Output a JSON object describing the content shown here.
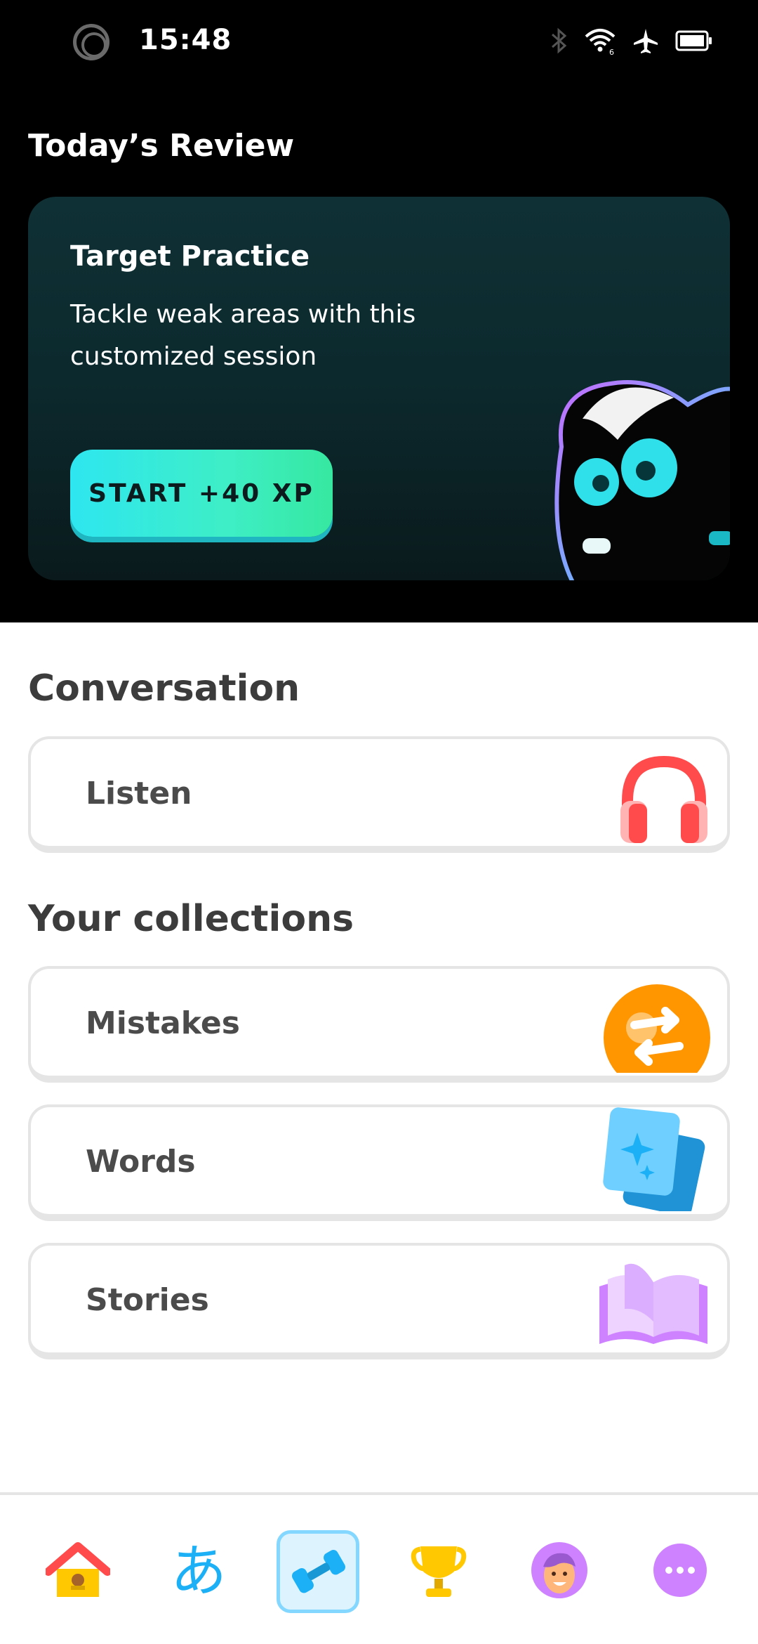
{
  "status_bar": {
    "time": "15:48"
  },
  "review": {
    "section_title": "Today’s Review",
    "card": {
      "title": "Target Practice",
      "description": "Tackle weak areas with this customized session",
      "start_label": "START +40 XP"
    }
  },
  "conversation": {
    "heading": "Conversation",
    "items": [
      {
        "label": "Listen",
        "icon": "headphones-icon"
      }
    ]
  },
  "collections": {
    "heading": "Your collections",
    "items": [
      {
        "label": "Mistakes",
        "icon": "repeat-arrows-icon"
      },
      {
        "label": "Words",
        "icon": "flashcards-icon"
      },
      {
        "label": "Stories",
        "icon": "open-book-icon"
      }
    ]
  },
  "nav": {
    "items": [
      {
        "name": "home",
        "icon": "house-icon"
      },
      {
        "name": "characters",
        "icon": "hiragana-a-icon",
        "glyph": "あ"
      },
      {
        "name": "practice",
        "icon": "dumbbell-icon",
        "active": true
      },
      {
        "name": "leaderboards",
        "icon": "trophy-icon"
      },
      {
        "name": "profile",
        "icon": "avatar-icon"
      },
      {
        "name": "more",
        "icon": "more-dots-icon"
      }
    ]
  },
  "colors": {
    "start_button": "#2ee6f0",
    "nav_active_border": "#84d8ff",
    "nav_active_bg": "#ddf4ff",
    "listen_red": "#ff4b4b",
    "mistakes_orange": "#ff9600",
    "words_blue": "#1cb0f6",
    "stories_purple": "#ce82ff"
  }
}
